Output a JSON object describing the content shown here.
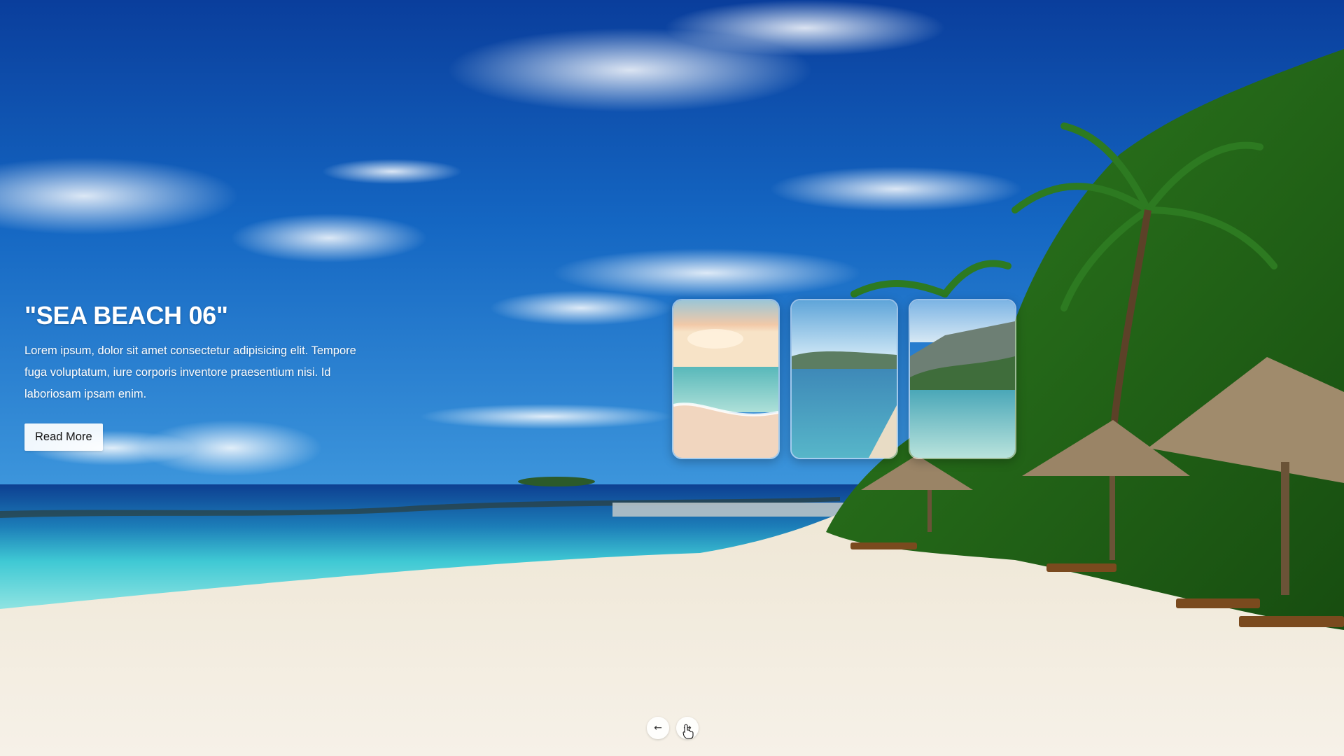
{
  "slide": {
    "title": "\"SEA BEACH 06\"",
    "description": "Lorem ipsum, dolor sit amet consectetur adipisicing elit. Tempore fuga voluptatum, iure corporis inventore praesentium nisi. Id laboriosam ipsam enim.",
    "button_label": "Read More"
  },
  "thumbnails": [
    {
      "name": "sunset-beach-thumbnail"
    },
    {
      "name": "bay-beach-thumbnail"
    },
    {
      "name": "cove-beach-thumbnail"
    }
  ],
  "navigation": {
    "prev_label": "←",
    "next_label": "→"
  },
  "icons": {
    "prev": "arrow-left-icon",
    "next": "arrow-right-icon",
    "cursor": "hand-pointer-icon"
  },
  "colors": {
    "sky": "#1466c2",
    "sea": "#3fc9d4",
    "sand": "#f3ede1",
    "button_bg": "#ffffff"
  }
}
